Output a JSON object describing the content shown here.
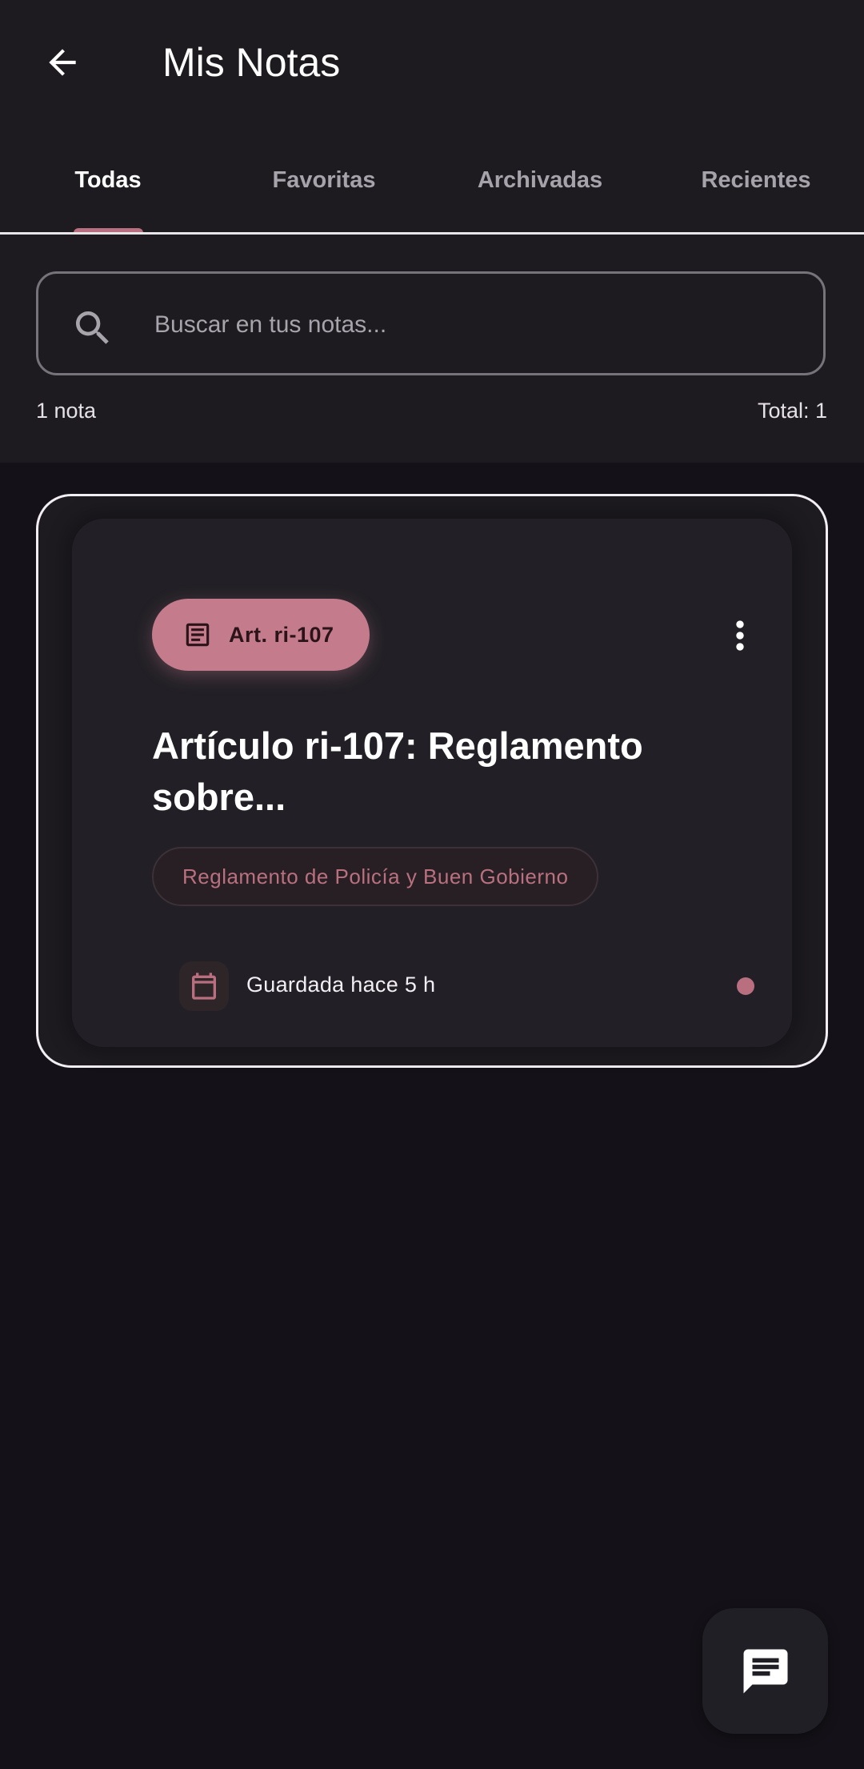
{
  "appbar": {
    "title": "Mis Notas",
    "back_icon": "arrow-back-icon"
  },
  "tabs": [
    {
      "label": "Todas",
      "active": true
    },
    {
      "label": "Favoritas",
      "active": false
    },
    {
      "label": "Archivadas",
      "active": false
    },
    {
      "label": "Recientes",
      "active": false
    }
  ],
  "search": {
    "placeholder": "Buscar en tus notas...",
    "value": "",
    "icon": "search-icon"
  },
  "summary": {
    "count_label": "1 nota",
    "total_label": "Total: 1"
  },
  "notes": [
    {
      "article_chip": "Art. ri-107",
      "article_icon": "article-icon",
      "title": "Artículo ri-107: Reglamento sobre...",
      "source": "Reglamento de Policía y Buen Gobierno",
      "saved": "Guardada hace 5 h",
      "date_icon": "calendar-icon",
      "menu_icon": "more-vert-icon"
    }
  ],
  "fab": {
    "icon": "chat-icon"
  },
  "colors": {
    "background": "#141218",
    "surface": "#1d1b20",
    "accent": "#c47b8b",
    "accent_text": "#b96f7f",
    "outline": "#77737b"
  }
}
